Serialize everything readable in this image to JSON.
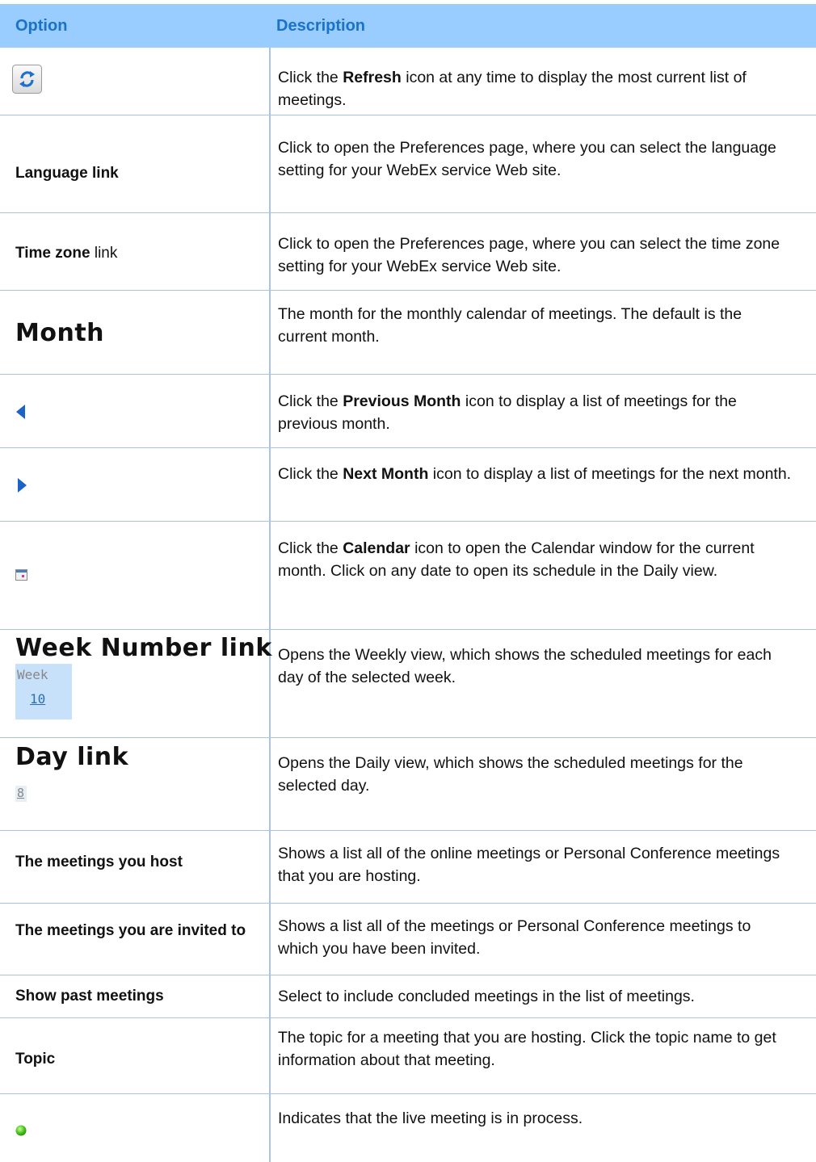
{
  "header": {
    "option": "Option",
    "description": "Description"
  },
  "rows": {
    "refresh": {
      "icon": "refresh-icon",
      "d1": "Click the ",
      "d_bold": "Refresh",
      "d2": " icon at any time to display the most current list of meetings."
    },
    "language": {
      "label": "Language link",
      "desc": "Click to open the Preferences page, where you can select the language setting for your WebEx service Web site."
    },
    "timezone": {
      "label_bold": "Time zone",
      "label_plain": " link",
      "desc": "Click to open the Preferences page, where you can select the time zone setting for your WebEx service Web site."
    },
    "month": {
      "label": "Month",
      "desc": "The month for the monthly calendar of meetings. The default is the current month."
    },
    "prev": {
      "icon": "previous-month-icon",
      "d1": "Click the ",
      "d_bold": "Previous Month",
      "d2": " icon to display a list of meetings for the previous month."
    },
    "next": {
      "icon": "next-month-icon",
      "d1": "Click the ",
      "d_bold": "Next Month",
      "d2": " icon to display a list of meetings for the next month."
    },
    "calendar": {
      "icon": "calendar-icon",
      "d1": "Click the ",
      "d_bold": "Calendar",
      "d2": " icon to open the Calendar window for the current month. Click on any date to open its schedule in the Daily view."
    },
    "week": {
      "label": "Week Number link",
      "sample_word": "Week",
      "sample_number": "10",
      "desc": "Opens the Weekly view, which shows the scheduled meetings for each day of the selected week."
    },
    "day": {
      "label": "Day link",
      "sample_number": "8",
      "desc": "Opens the Daily view, which shows the scheduled meetings for the selected day."
    },
    "host": {
      "label": "The meetings you host",
      "desc": "Shows a list all of the online meetings or Personal Conference meetings that you are hosting."
    },
    "invited": {
      "label": "The meetings you are invited to",
      "desc": "Shows a list all of the meetings or Personal Conference meetings to which you have been invited."
    },
    "past": {
      "label": "Show past meetings",
      "desc": "Select to include concluded meetings in the list of meetings."
    },
    "topic": {
      "label": "Topic",
      "desc": "The topic for a meeting that you are hosting. Click the topic name to get information about that meeting."
    },
    "live": {
      "icon": "live-meeting-status-icon",
      "desc": "Indicates that the live meeting is in process."
    }
  },
  "colors": {
    "header_bg": "#99ccff",
    "header_text": "#1a73c8",
    "grid": "#a9c3e0"
  }
}
